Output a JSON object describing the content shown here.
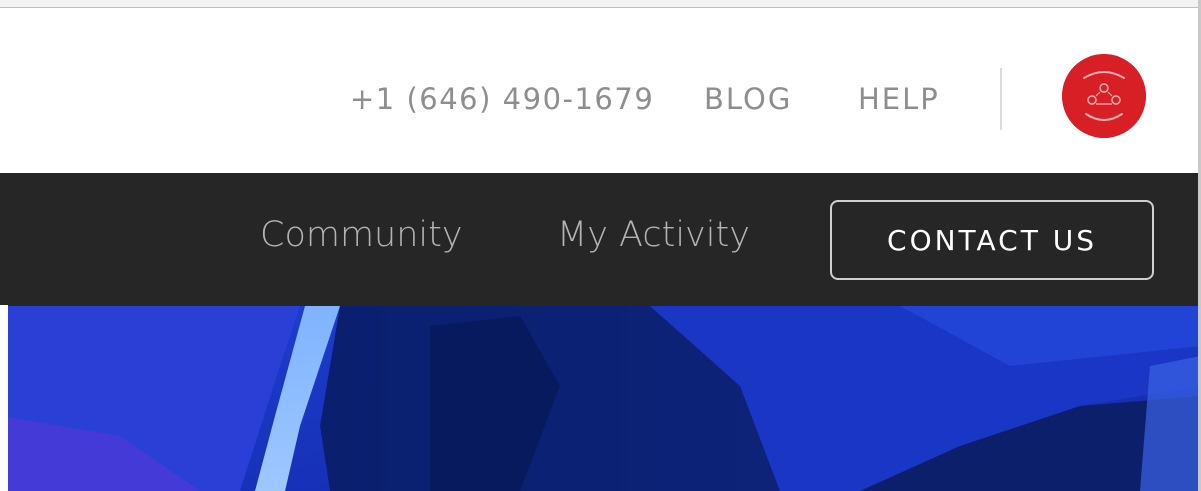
{
  "utility_bar": {
    "phone": "+1 (646) 490-1679",
    "blog_label": "BLOG",
    "help_label": "HELP",
    "avatar_color": "#d81f26"
  },
  "main_nav": {
    "items": [
      {
        "label": "Community"
      },
      {
        "label": "My Activity"
      }
    ],
    "contact_label": "CONTACT US",
    "background": "#262626"
  },
  "hero": {
    "primary_color": "#1533b8"
  }
}
